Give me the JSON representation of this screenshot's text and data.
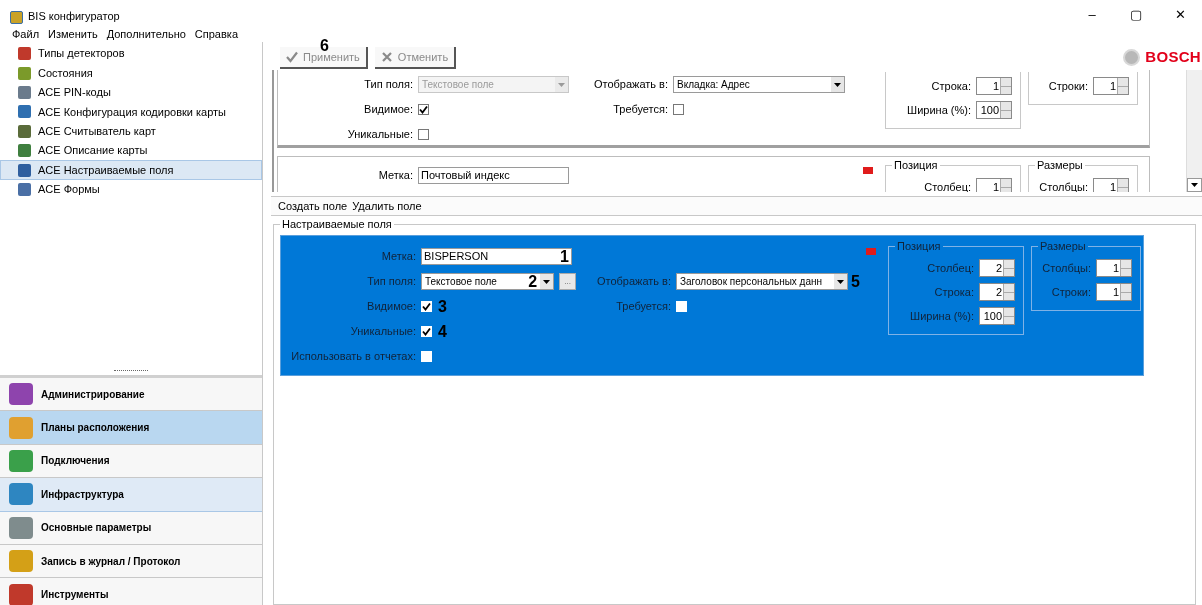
{
  "window": {
    "title": "BIS конфигуратор",
    "controls": [
      "–",
      "▢",
      "✕"
    ]
  },
  "menu": [
    "Файл",
    "Изменить",
    "Дополнительно",
    "Справка"
  ],
  "tree": [
    {
      "label": "Типы детекторов",
      "selected": false,
      "color": "#c0392b"
    },
    {
      "label": "Состояния",
      "selected": false,
      "color": "#7b9a2a"
    },
    {
      "label": "ACE PIN-коды",
      "selected": false,
      "color": "#6b7b8c"
    },
    {
      "label": "ACE Конфигурация кодировки карты",
      "selected": false,
      "color": "#2f6fb0"
    },
    {
      "label": "ACE Считыватель карт",
      "selected": false,
      "color": "#5a6b3a"
    },
    {
      "label": "ACE Описание карты",
      "selected": false,
      "color": "#3f7f3f"
    },
    {
      "label": "ACE Настраиваемые поля",
      "selected": true,
      "color": "#2f5f9f"
    },
    {
      "label": "ACE Формы",
      "selected": false,
      "color": "#4a6fa5"
    }
  ],
  "nav": [
    {
      "label": "Администрирование",
      "selected": false,
      "hover": false,
      "color": "#8e44ad"
    },
    {
      "label": "Планы расположения",
      "selected": true,
      "hover": false,
      "color": "#e0a030"
    },
    {
      "label": "Подключения",
      "selected": false,
      "hover": false,
      "color": "#3aa04a"
    },
    {
      "label": "Инфраструктура",
      "selected": false,
      "hover": true,
      "color": "#2e86c1"
    },
    {
      "label": "Основные параметры",
      "selected": false,
      "hover": false,
      "color": "#7f8c8d"
    },
    {
      "label": "Запись в журнал / Протокол",
      "selected": false,
      "hover": false,
      "color": "#d4a017"
    },
    {
      "label": "Инструменты",
      "selected": false,
      "hover": false,
      "color": "#c0392b"
    }
  ],
  "toolbar": [
    {
      "kind": "apply",
      "label": "Применить",
      "disabled": true,
      "callout": "6"
    },
    {
      "kind": "cancel",
      "label": "Отменить",
      "disabled": true
    }
  ],
  "logo": {
    "text": "BOSCH"
  },
  "upper_records": [
    {
      "selected": false,
      "marker": false,
      "left": [
        {
          "kind": "dropdown",
          "label": "Тип поля:",
          "value": "Текстовое поле",
          "disabled": true
        },
        {
          "kind": "checkbox",
          "label": "Видимое:",
          "checked": true
        },
        {
          "kind": "checkbox",
          "label": "Уникальные:",
          "checked": false
        }
      ],
      "middle": [
        {
          "kind": "dropdown",
          "label": "Отображать в:",
          "value": "Вкладка: Адрес",
          "disabled": false
        },
        {
          "kind": "checkbox",
          "label": "Требуется:",
          "checked": false
        }
      ],
      "position": {
        "fields": [
          {
            "label": "Строка:",
            "value": "1"
          },
          {
            "label": "Ширина (%):",
            "value": "100"
          }
        ]
      },
      "sizes": {
        "fields": [
          {
            "label": "Строки:",
            "value": "1"
          }
        ]
      }
    },
    {
      "selected": false,
      "marker": true,
      "left": [
        {
          "kind": "text",
          "label": "Метка:",
          "value": "Почтовый индекс"
        }
      ],
      "position": {
        "legend": "Позиция",
        "fields": [
          {
            "label": "Столбец:",
            "value": "1"
          }
        ]
      },
      "sizes": {
        "legend": "Размеры",
        "fields": [
          {
            "label": "Столбцы:",
            "value": "1"
          }
        ]
      }
    }
  ],
  "lower_toolbar": [
    "Создать поле",
    "Удалить поле"
  ],
  "group": {
    "legend": "Настраиваемые поля",
    "records": [
      {
        "selected": true,
        "marker": true,
        "left": [
          {
            "kind": "text",
            "label": "Метка:",
            "value": "BISPERSON",
            "callout": "1"
          },
          {
            "kind": "dropdown",
            "label": "Тип поля:",
            "value": "Текстовое поле",
            "disabled": false,
            "callout": "2",
            "more": "..."
          },
          {
            "kind": "checkbox",
            "label": "Видимое:",
            "checked": true,
            "callout": "3"
          },
          {
            "kind": "checkbox",
            "label": "Уникальные:",
            "checked": true,
            "callout": "4"
          },
          {
            "kind": "checkbox",
            "label": "Использовать в отчетах:",
            "checked": false
          }
        ],
        "middle": [
          {
            "kind": "dropdown",
            "label": "Отображать в:",
            "value": "Заголовок персональных данн",
            "disabled": false,
            "callout": "5"
          },
          {
            "kind": "checkbox",
            "label": "Требуется:",
            "checked": false
          }
        ],
        "position": {
          "legend": "Позиция",
          "fields": [
            {
              "label": "Столбец:",
              "value": "2"
            },
            {
              "label": "Строка:",
              "value": "2"
            },
            {
              "label": "Ширина (%):",
              "value": "100"
            }
          ]
        },
        "sizes": {
          "legend": "Размеры",
          "fields": [
            {
              "label": "Столбцы:",
              "value": "1"
            },
            {
              "label": "Строки:",
              "value": "1"
            }
          ]
        }
      }
    ]
  }
}
